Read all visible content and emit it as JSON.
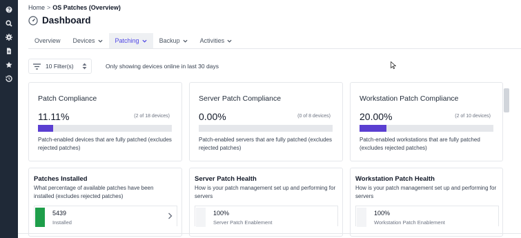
{
  "breadcrumb": {
    "home": "Home",
    "separator": ">",
    "current": "OS Patches (Overview)"
  },
  "page": {
    "title": "Dashboard"
  },
  "tabs": [
    {
      "label": "Overview",
      "has_dropdown": false,
      "active": false
    },
    {
      "label": "Devices",
      "has_dropdown": true,
      "active": false
    },
    {
      "label": "Patching",
      "has_dropdown": true,
      "active": true
    },
    {
      "label": "Backup",
      "has_dropdown": true,
      "active": false
    },
    {
      "label": "Activities",
      "has_dropdown": true,
      "active": false
    }
  ],
  "filter": {
    "label": "10 Filter(s)",
    "note": "Only showing devices online in last 30 days"
  },
  "compliance_cards": [
    {
      "title": "Patch Compliance",
      "percent": "11.11%",
      "count": "(2 of 18 devices)",
      "fraction": 0.1111,
      "desc": "Patch-enabled devices that are fully patched (excludes rejected patches)"
    },
    {
      "title": "Server Patch Compliance",
      "percent": "0.00%",
      "count": "(0 of 8 devices)",
      "fraction": 0.0,
      "desc": "Patch-enabled servers that are fully patched (excludes rejected patches)"
    },
    {
      "title": "Workstation Patch Compliance",
      "percent": "20.00%",
      "count": "(2 of 10 devices)",
      "fraction": 0.2,
      "desc": "Patch-enabled workstations that are fully patched (excludes rejected patches)"
    }
  ],
  "health_cards": [
    {
      "title": "Patches Installed",
      "desc": "What percentage of available patches have been installed (excludes rejected patches)",
      "value": "5439",
      "label": "Installed",
      "swatch": "#1e9e4a"
    },
    {
      "title": "Server Patch Health",
      "desc": "How is your patch management set up and performing for servers",
      "value": "100%",
      "label": "Server Patch Enablement",
      "swatch": "#f3f4f6"
    },
    {
      "title": "Workstation Patch Health",
      "desc": "How is your patch management set up and performing for servers",
      "value": "100%",
      "label": "Workstation Patch Enablement",
      "swatch": "#f3f4f6"
    }
  ],
  "colors": {
    "sidebar": "#1f2937",
    "accent": "#4f46e5",
    "bar_fill": "#5b3fd1",
    "installed_green": "#1e9e4a"
  },
  "sidebar_icons": [
    "help-icon",
    "search-icon",
    "gear-icon",
    "document-icon",
    "star-icon",
    "history-icon"
  ]
}
